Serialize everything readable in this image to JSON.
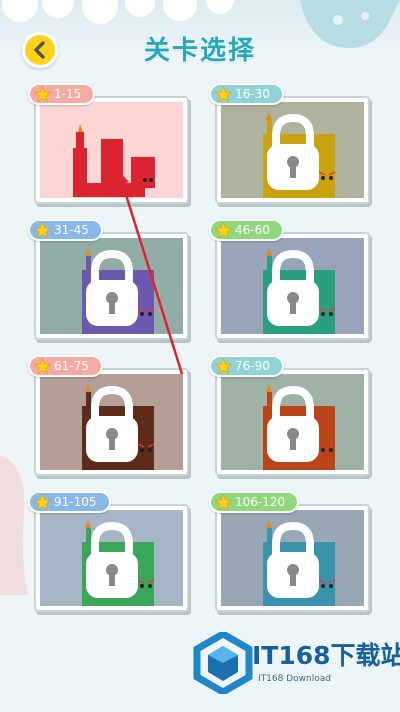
{
  "header": {
    "title": "关卡选择",
    "back_icon": "chevron-left-icon"
  },
  "levels": [
    {
      "range": "1-15",
      "locked": false,
      "snake_color": "#dc2430",
      "bg_color": "#fcd5d5",
      "badge_color": "#f5aaa4"
    },
    {
      "range": "16-30",
      "locked": true,
      "snake_color": "#c9a20f",
      "bg_color": "#aeb39e",
      "badge_color": "#8fd3d6"
    },
    {
      "range": "31-45",
      "locked": true,
      "snake_color": "#6d58ad",
      "bg_color": "#92ada8",
      "badge_color": "#87b8e9"
    },
    {
      "range": "46-60",
      "locked": true,
      "snake_color": "#2a9f80",
      "bg_color": "#99a4ba",
      "badge_color": "#8fd87c"
    },
    {
      "range": "61-75",
      "locked": true,
      "snake_color": "#5e2a1a",
      "bg_color": "#b59d98",
      "badge_color": "#f5aaa4"
    },
    {
      "range": "76-90",
      "locked": true,
      "snake_color": "#b84418",
      "bg_color": "#9fb1a5",
      "badge_color": "#8fd3d6"
    },
    {
      "range": "91-105",
      "locked": true,
      "snake_color": "#3aa657",
      "bg_color": "#a7b6c6",
      "badge_color": "#87b8e9"
    },
    {
      "range": "106-120",
      "locked": true,
      "snake_color": "#3a93ad",
      "bg_color": "#99a6b6",
      "badge_color": "#8fd87c"
    }
  ],
  "watermark": {
    "main": "IT168下载站",
    "sub": "IT168 Download"
  },
  "colors": {
    "title": "#23a9b8",
    "back_button": "#ffd21e",
    "annotation_arrow": "#d7262c"
  }
}
